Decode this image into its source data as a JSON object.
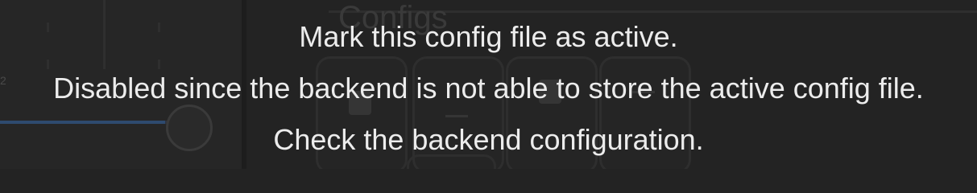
{
  "background": {
    "section_title": "Configs",
    "left_panel_label": "2"
  },
  "tooltip": {
    "line1": "Mark this config file as active.",
    "line2": "Disabled since the backend is not able to store the active config file.",
    "line3": "Check the backend configuration."
  },
  "colors": {
    "page_bg": "#232323",
    "tooltip_text": "#ececec",
    "slider_accent": "#2f4f78"
  },
  "icons": {
    "save": "floppy-icon",
    "download": "download-icon",
    "file": "file-icon",
    "upload": "upload-icon"
  }
}
